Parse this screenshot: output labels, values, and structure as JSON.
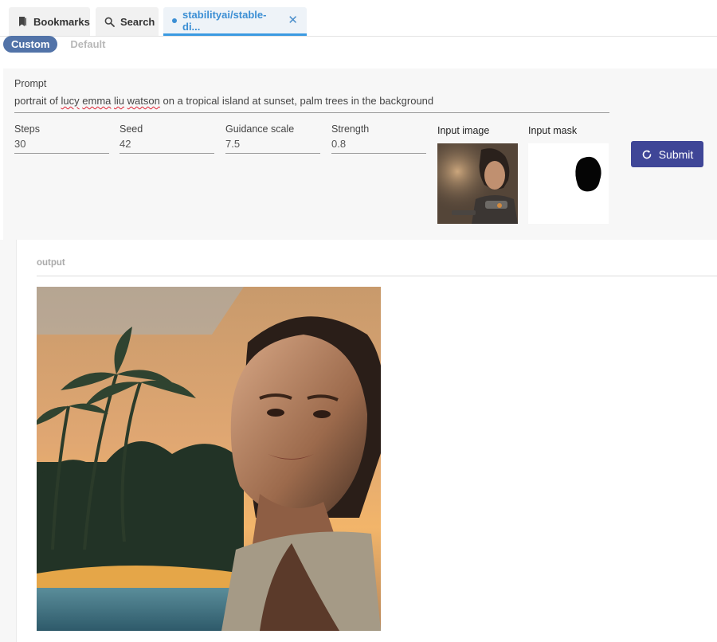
{
  "tabs": [
    {
      "label": "Bookmarks",
      "icon": "bookmark-icon"
    },
    {
      "label": "Search",
      "icon": "search-icon"
    },
    {
      "label": "stabilityai/stable-di...",
      "icon": "status-dot-icon",
      "active": true
    }
  ],
  "mode": {
    "custom": "Custom",
    "default": "Default",
    "selected": "Custom"
  },
  "form": {
    "prompt": {
      "label": "Prompt",
      "value_before": "portrait of ",
      "misspelled": [
        "lucy",
        "emma",
        "liu",
        "watson"
      ],
      "value_after": " on a tropical island at sunset, palm trees in the background"
    },
    "steps": {
      "label": "Steps",
      "value": "30"
    },
    "seed": {
      "label": "Seed",
      "value": "42"
    },
    "guidance": {
      "label": "Guidance scale",
      "value": "7.5"
    },
    "strength": {
      "label": "Strength",
      "value": "0.8"
    },
    "input_image": {
      "label": "Input image"
    },
    "input_mask": {
      "label": "Input mask"
    },
    "submit": {
      "label": "Submit",
      "icon": "refresh-icon"
    }
  },
  "output": {
    "label": "output"
  },
  "colors": {
    "accent": "#3c8fd4",
    "toggle": "#5273a8",
    "submit": "#3f4697"
  }
}
